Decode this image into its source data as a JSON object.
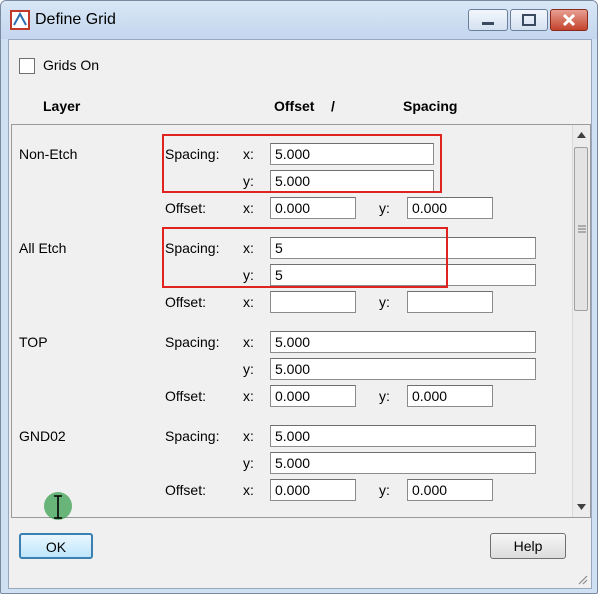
{
  "window": {
    "title": "Define Grid"
  },
  "titlebar": {
    "icons": [
      "minimize-icon",
      "maximize-icon",
      "close-icon"
    ]
  },
  "grids_on": {
    "label": "Grids On",
    "checked": false
  },
  "headers": {
    "layer": "Layer",
    "offset": "Offset",
    "slash": "/",
    "spacing": "Spacing"
  },
  "rows": [
    {
      "layer": "Non-Etch",
      "spacing_label": "Spacing:",
      "offset_label": "Offset:",
      "x_label": "x:",
      "y_label": "y:",
      "spacing_x": "5.000",
      "spacing_y": "5.000",
      "offset_x": "0.000",
      "offset_y": "0.000"
    },
    {
      "layer": "All Etch",
      "spacing_label": "Spacing:",
      "offset_label": "Offset:",
      "x_label": "x:",
      "y_label": "y:",
      "spacing_x": "5",
      "spacing_y": "5",
      "offset_x": "",
      "offset_y": ""
    },
    {
      "layer": "TOP",
      "spacing_label": "Spacing:",
      "offset_label": "Offset:",
      "x_label": "x:",
      "y_label": "y:",
      "spacing_x": "5.000",
      "spacing_y": "5.000",
      "offset_x": "0.000",
      "offset_y": "0.000"
    },
    {
      "layer": "GND02",
      "spacing_label": "Spacing:",
      "offset_label": "Offset:",
      "x_label": "x:",
      "y_label": "y:",
      "spacing_x": "5.000",
      "spacing_y": "5.000",
      "offset_x": "0.000",
      "offset_y": "0.000"
    }
  ],
  "buttons": {
    "ok": "OK",
    "help": "Help"
  },
  "colors": {
    "highlight": "#e0231f",
    "title_bar": "#c9dbf0",
    "close_button": "#c4432d"
  }
}
